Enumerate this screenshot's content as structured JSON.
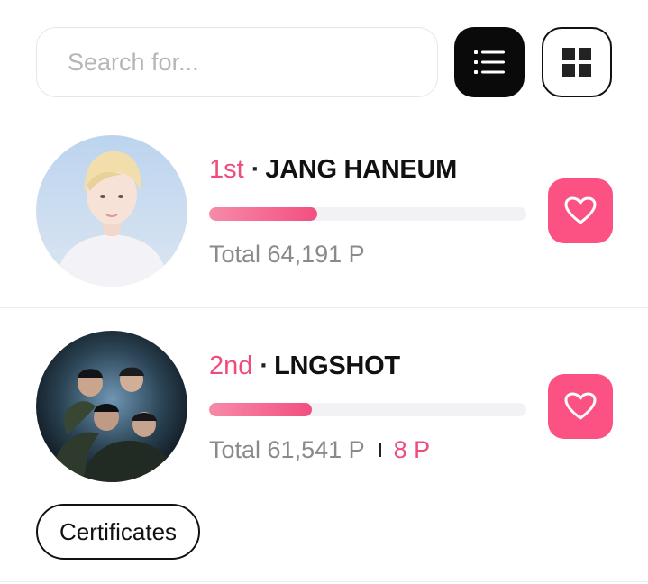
{
  "search": {
    "placeholder": "Search for...",
    "value": ""
  },
  "view_toggle": {
    "list_icon": "list-icon",
    "grid_icon": "grid-icon",
    "active": "list"
  },
  "ranking": [
    {
      "rank": "1st",
      "separator": "·",
      "name": "JANG HANEUM",
      "progress_fraction": 0.34,
      "total": "Total 64,191 P",
      "extra": "",
      "avatar": "portrait-photo"
    },
    {
      "rank": "2nd",
      "separator": "·",
      "name": "LNGSHOT",
      "progress_fraction": 0.325,
      "total": "Total 61,541 P",
      "extra": "8 P",
      "avatar": "group-photo",
      "certificates_label": "Certificates"
    }
  ],
  "colors": {
    "accent": "#fb5283",
    "rank_text": "#ee4d7c",
    "bar_start": "#f78aa8",
    "bar_end": "#f24f80",
    "active_toggle": "#0a0a0a"
  }
}
